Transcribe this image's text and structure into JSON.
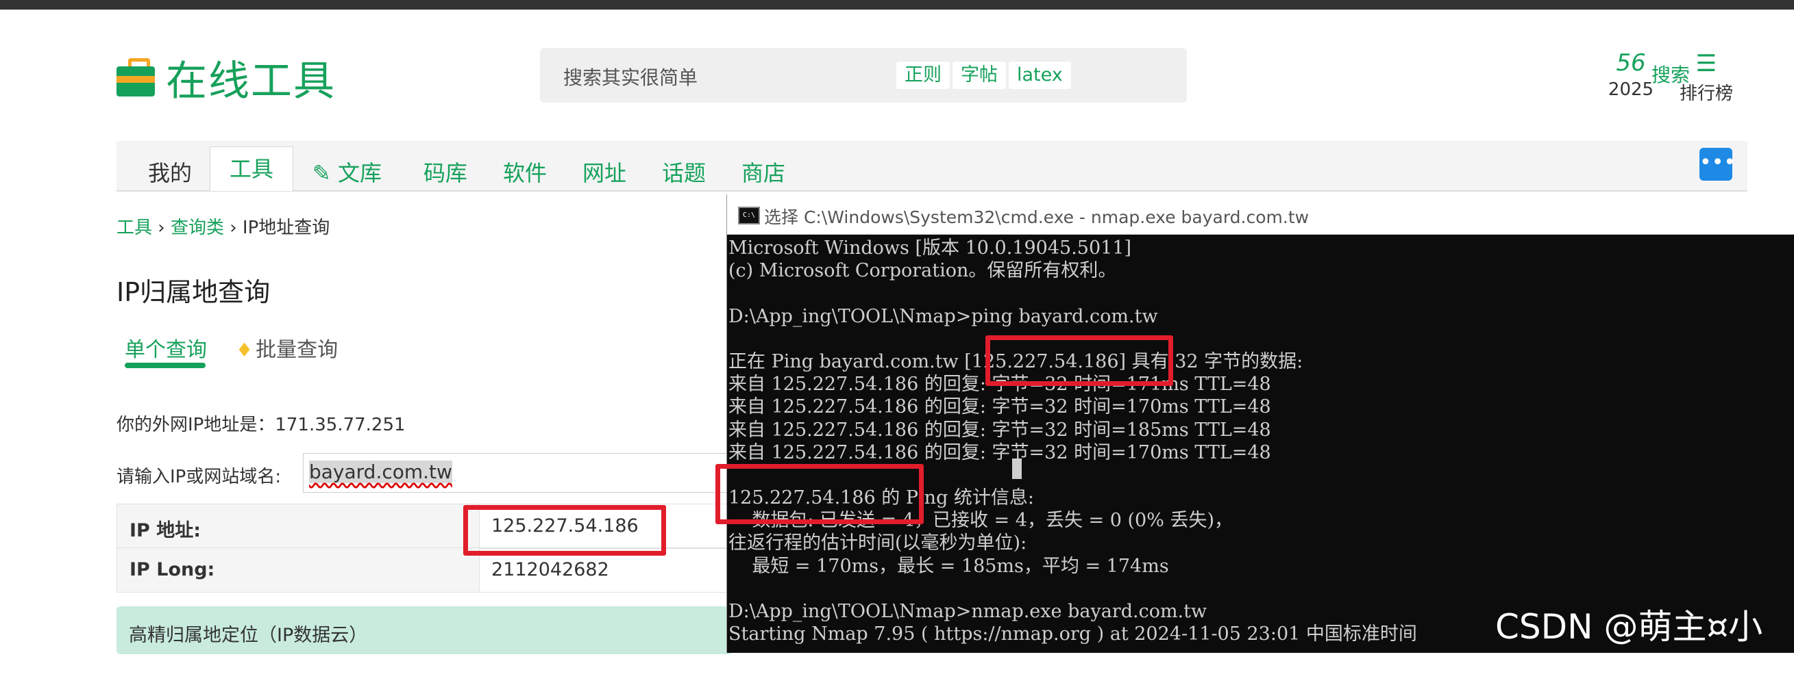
{
  "header": {
    "logo_text": "在线工具",
    "search_placeholder": "搜索其实很简单",
    "chips": [
      "正则",
      "字帖",
      "latex"
    ],
    "search_button": "搜索",
    "count": "56",
    "year": "2025",
    "rank_label": "排行榜",
    "icons": {
      "logo": "toolbox-icon",
      "rank": "list-icon",
      "chat": "chat-icon"
    }
  },
  "nav": {
    "items": [
      "我的",
      "工具",
      "文库",
      "码库",
      "软件",
      "网址",
      "话题",
      "商店"
    ],
    "active": "工具"
  },
  "breadcrumb": {
    "items": [
      "工具",
      "查询类",
      "IP地址查询"
    ],
    "separator": "›"
  },
  "page": {
    "title": "IP归属地查询",
    "tab_single": "单个查询",
    "tab_batch": "批量查询",
    "my_ip_line": "你的外网IP地址是：171.35.77.251",
    "input_label": "请输入IP或网站域名:",
    "input_value": "bayard.com.tw",
    "table": [
      {
        "key": "IP 地址:",
        "value": "125.227.54.186"
      },
      {
        "key": "IP Long:",
        "value": "2112042682"
      }
    ],
    "precise_label": "高精归属地定位（IP数据云）"
  },
  "cmd": {
    "title": "选择 C:\\Windows\\System32\\cmd.exe - nmap.exe  bayard.com.tw",
    "icon_text": "C:\\",
    "lines": [
      "Microsoft Windows [版本 10.0.19045.5011]",
      "(c) Microsoft Corporation。保留所有权利。",
      "",
      "D:\\App_ing\\TOOL\\Nmap>ping bayard.com.tw",
      "",
      "正在 Ping bayard.com.tw [125.227.54.186] 具有 32 字节的数据:",
      "来自 125.227.54.186 的回复: 字节=32 时间=171ms TTL=48",
      "来自 125.227.54.186 的回复: 字节=32 时间=170ms TTL=48",
      "来自 125.227.54.186 的回复: 字节=32 时间=185ms TTL=48",
      "来自 125.227.54.186 的回复: 字节=32 时间=170ms TTL=48",
      "",
      "125.227.54.186 的 Ping 统计信息:",
      "    数据包: 已发送 = 4，已接收 = 4，丢失 = 0 (0% 丢失)，",
      "往返行程的估计时间(以毫秒为单位):",
      "    最短 = 170ms，最长 = 185ms，平均 = 174ms",
      "",
      "D:\\App_ing\\TOOL\\Nmap>nmap.exe bayard.com.tw",
      "Starting Nmap 7.95 ( https://nmap.org ) at 2024-11-05 23:01 中国标准时间"
    ]
  },
  "watermark": "CSDN @萌主¤小狸",
  "colors": {
    "brand": "#16a15b",
    "highlight": "#e11d2b",
    "console_bg": "#0c0c0c"
  }
}
